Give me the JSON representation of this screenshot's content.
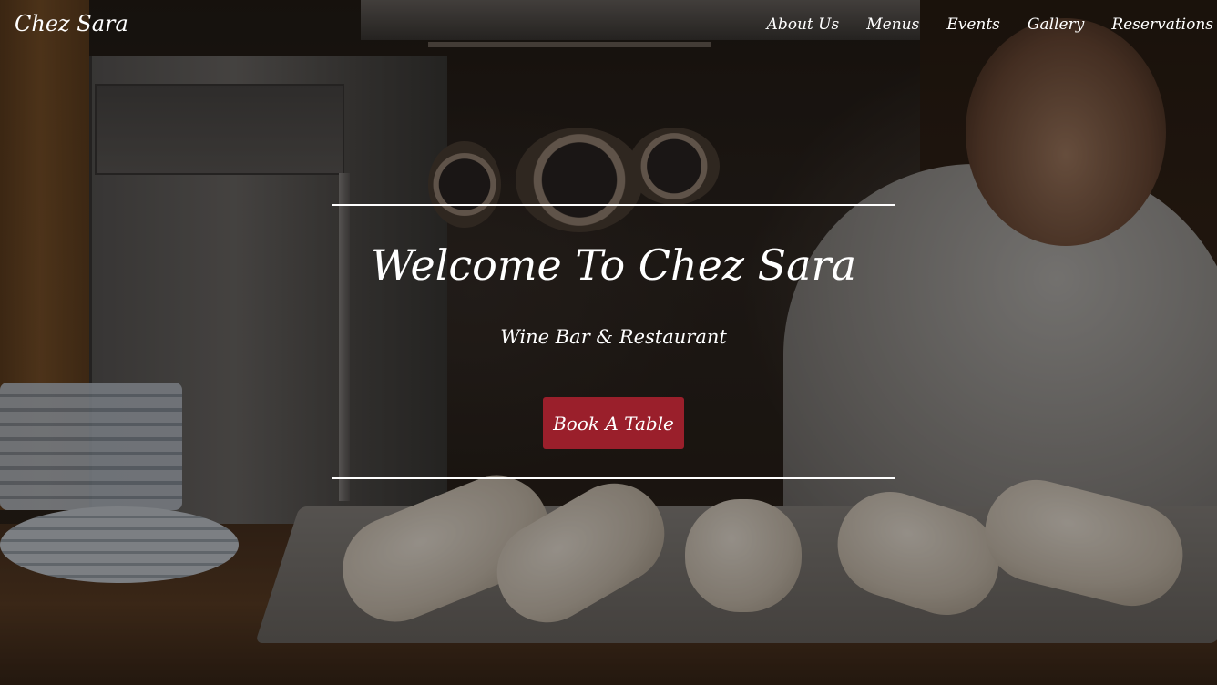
{
  "site": {
    "brand": "Chez Sara"
  },
  "nav": {
    "items": [
      {
        "label": "About Us"
      },
      {
        "label": "Menus"
      },
      {
        "label": "Events"
      },
      {
        "label": "Gallery"
      },
      {
        "label": "Reservations"
      }
    ]
  },
  "hero": {
    "title": "Welcome To Chez Sara",
    "subtitle": "Wine Bar & Restaurant",
    "cta_label": "Book A Table"
  },
  "colors": {
    "cta_background": "#9a1f2b",
    "text": "#ffffff",
    "rule": "#ffffff"
  }
}
